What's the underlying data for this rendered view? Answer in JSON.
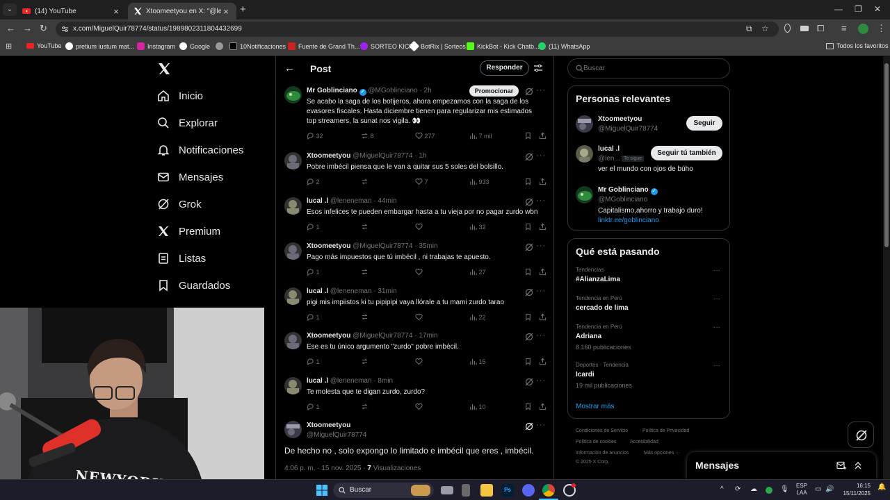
{
  "browser": {
    "tabs": [
      {
        "title": "(14) YouTube",
        "active": false
      },
      {
        "title": "Xtoomeetyou en X: \"@leneneman\" / X",
        "active": true
      }
    ],
    "url": "x.com/MiguelQuir78774/status/1989802311804432699",
    "bookmarks": [
      "YouTube",
      "pretium iustum mat...",
      "Instagram",
      "Google",
      "",
      "10Notificaciones",
      "Fuente de Grand Th...",
      "SORTEO KICK",
      "BotRix | Sorteos",
      "KickBot - Kick Chatb...",
      "(11) WhatsApp"
    ],
    "all_bookmarks": "Todos los favoritos"
  },
  "nav": {
    "items": [
      {
        "label": "Inicio",
        "icon": "home-icon"
      },
      {
        "label": "Explorar",
        "icon": "search-icon"
      },
      {
        "label": "Notificaciones",
        "icon": "bell-icon"
      },
      {
        "label": "Mensajes",
        "icon": "envelope-icon"
      },
      {
        "label": "Grok",
        "icon": "grok-icon"
      },
      {
        "label": "Premium",
        "icon": "x-logo-icon"
      },
      {
        "label": "Listas",
        "icon": "list-icon"
      },
      {
        "label": "Guardados",
        "icon": "bookmark-icon"
      }
    ]
  },
  "header": {
    "title": "Post",
    "reply_button": "Responder"
  },
  "tweets": [
    {
      "name": "Mr Goblinciano",
      "verified": true,
      "handle": "@MGoblinciano · 2h",
      "promote": "Promocionar",
      "text": "Se acabo la saga de los botijeros, ahora empezamos con la saga de los evasores fiscales. Hasta diciembre tienen para regularizar mis estimados top streamers, la sunat nos vigila. 👀",
      "replies": "32",
      "reposts": "8",
      "likes": "277",
      "views": "7 mil",
      "avatar": "#2e8b3c"
    },
    {
      "name": "Xtoomeetyou",
      "handle": "@MiguelQuir78774 · 1h",
      "text": "Pobre imbécil piensa que le van a quitar sus 5 soles del bolsillo.",
      "replies": "2",
      "reposts": "",
      "likes": "7",
      "views": "933",
      "avatar": "#6a6a78"
    },
    {
      "name": "lucal .l",
      "handle": "@leneneman · 44min",
      "text": "Esos infelices te pueden embargar hasta a tu vieja por no pagar zurdo wbn",
      "replies": "1",
      "reposts": "",
      "likes": "",
      "views": "32",
      "avatar": "#8a8a70"
    },
    {
      "name": "Xtoomeetyou",
      "handle": "@MiguelQuir78774 · 35min",
      "text": "Pago más impuestos que tú imbécil , ni trabajas te apuesto.",
      "replies": "1",
      "reposts": "",
      "likes": "",
      "views": "27",
      "avatar": "#6a6a78"
    },
    {
      "name": "lucal .l",
      "handle": "@leneneman · 31min",
      "text": "pigi mis impiistos ki tu pipipipi vaya llórale a tu mami zurdo tarao",
      "replies": "1",
      "reposts": "",
      "likes": "",
      "views": "22",
      "avatar": "#8a8a70"
    },
    {
      "name": "Xtoomeetyou",
      "handle": "@MiguelQuir78774 · 17min",
      "text": "Ese es tu único argumento \"zurdo\" pobre imbécil.",
      "replies": "1",
      "reposts": "",
      "likes": "",
      "views": "15",
      "avatar": "#6a6a78"
    },
    {
      "name": "lucal .l",
      "handle": "@leneneman · 8min",
      "text": "Te molesta que te digan zurdo, zurdo?",
      "replies": "1",
      "reposts": "",
      "likes": "",
      "views": "10",
      "avatar": "#8a8a70"
    }
  ],
  "main_tweet": {
    "name": "Xtoomeetyou",
    "handle": "@MiguelQuir78774",
    "text": "De hecho no , solo expongo lo limitado e imbécil que eres , imbécil.",
    "time": "4:06 p. m. · 15 nov. 2025 ·",
    "views_count": "7",
    "views_label": "Visualizaciones"
  },
  "search": {
    "placeholder": "Buscar"
  },
  "relevant": {
    "title": "Personas relevantes",
    "people": [
      {
        "name": "Xtoomeetyou",
        "handle": "@MiguelQuir78774",
        "button": "Seguir",
        "bio": ""
      },
      {
        "name": "lucal .l",
        "handle": "@len...",
        "badge": "Te sigue",
        "button": "Seguir tú también",
        "bio": "ver el mundo con ojos de búho"
      },
      {
        "name": "Mr Goblinciano",
        "handle": "@MGoblinciano",
        "button": "",
        "bio": "Capitalismo,ahorro y trabajo duro!",
        "link": "linktr.ee/goblinciano"
      }
    ]
  },
  "trends": {
    "title": "Qué está pasando",
    "items": [
      {
        "context": "Tendencias",
        "name": "#AlianzaLima",
        "count": ""
      },
      {
        "context": "Tendencia en Perú",
        "name": "cercado de lima",
        "count": ""
      },
      {
        "context": "Tendencia en Perú",
        "name": "Adriana",
        "count": "8.160 publicaciones"
      },
      {
        "context": "Deportes · Tendencia",
        "name": "Icardi",
        "count": "19 mil publicaciones"
      }
    ],
    "more": "Mostrar más"
  },
  "footer": [
    "Condiciones de Servicio",
    "Política de Privacidad",
    "Política de cookies",
    "Accesibilidad",
    "Información de anuncios",
    "Más opciones ···",
    "© 2025 X Corp."
  ],
  "messages": {
    "title": "Mensajes"
  },
  "taskbar": {
    "search": "Buscar",
    "lang": "ESP",
    "lang2": "LAA",
    "time": "16:15",
    "date": "15/11/2025"
  },
  "webcam": {
    "hoodie_text": "NEWYORK"
  },
  "colors": {
    "accent": "#1d9bf0",
    "border": "#2f3336",
    "muted": "#71767b"
  }
}
